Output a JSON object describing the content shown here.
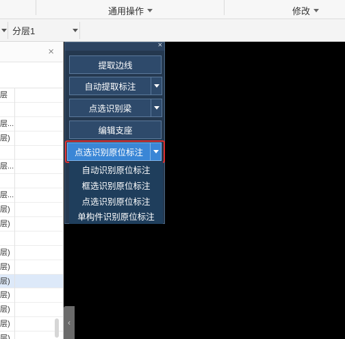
{
  "ribbon": {
    "group_common": "通用操作",
    "group_modify": "修改"
  },
  "toolbar2": {
    "floor_value": "分层1"
  },
  "left_panel": {
    "close_label": "×",
    "rows": [
      {
        "text": "层",
        "selected": false
      },
      {
        "text": "",
        "selected": false
      },
      {
        "text": "层...",
        "selected": false
      },
      {
        "text": "层)",
        "selected": false
      },
      {
        "text": "",
        "selected": false
      },
      {
        "text": "层...",
        "selected": false
      },
      {
        "text": "",
        "selected": false
      },
      {
        "text": "层...",
        "selected": false
      },
      {
        "text": "层)",
        "selected": false
      },
      {
        "text": "层)",
        "selected": false
      },
      {
        "text": "",
        "selected": false
      },
      {
        "text": "层)",
        "selected": false
      },
      {
        "text": "层)",
        "selected": false
      },
      {
        "text": "层)",
        "selected": true
      },
      {
        "text": "层)",
        "selected": false
      },
      {
        "text": "层)",
        "selected": false
      },
      {
        "text": "层)",
        "selected": false
      },
      {
        "text": "层)",
        "selected": false
      }
    ]
  },
  "toolbox": {
    "close_label": "×",
    "btn_extract_edge": "提取边线",
    "btn_auto_extract_label": "自动提取标注",
    "btn_pick_identify_beam": "点选识别梁",
    "btn_edit_support": "编辑支座",
    "btn_pick_identify_origin": "点选识别原位标注"
  },
  "submenu": {
    "items": [
      "自动识别原位标注",
      "框选识别原位标注",
      "点选识别原位标注",
      "单构件识别原位标注"
    ]
  },
  "canvas": {
    "collapse_label": "‹"
  }
}
